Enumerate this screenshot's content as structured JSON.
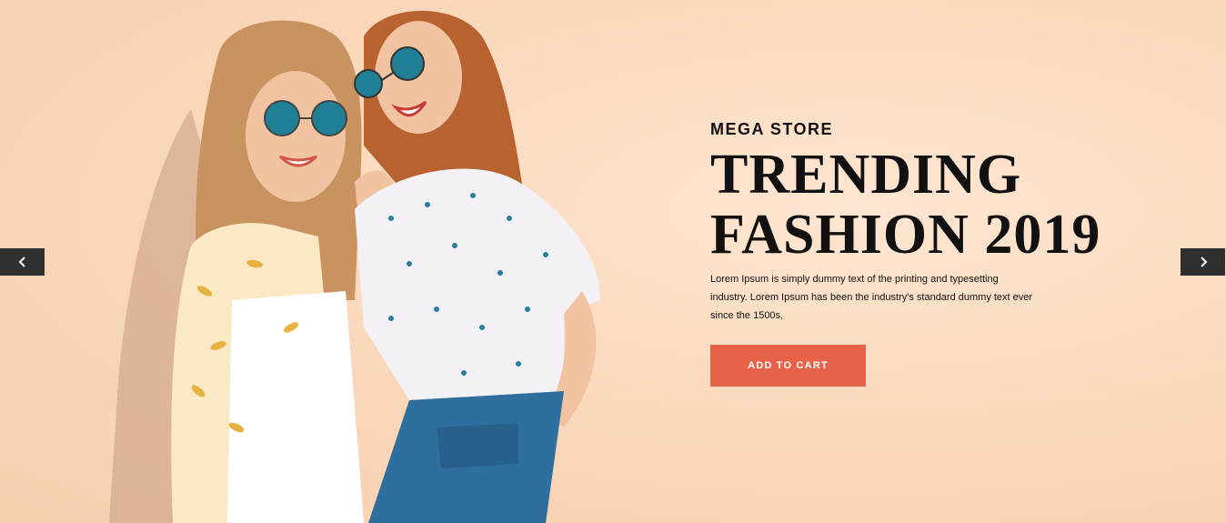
{
  "hero": {
    "eyebrow": "MEGA STORE",
    "title_line1": "TRENDING",
    "title_line2": "FASHION 2019",
    "description": "Lorem Ipsum is simply dummy text of the printing and typesetting industry. Lorem Ipsum has been the industry's standard dummy text ever since the 1500s,",
    "cta_label": "ADD TO CART",
    "image_alt": "Two smiling women wearing round mirrored sunglasses"
  },
  "carousel": {
    "prev_icon": "chevron-left-icon",
    "next_icon": "chevron-right-icon"
  },
  "colors": {
    "background": "#f9d5b6",
    "accent": "#e8624a",
    "arrow_bg": "#2f2f2f",
    "text": "#111111"
  }
}
